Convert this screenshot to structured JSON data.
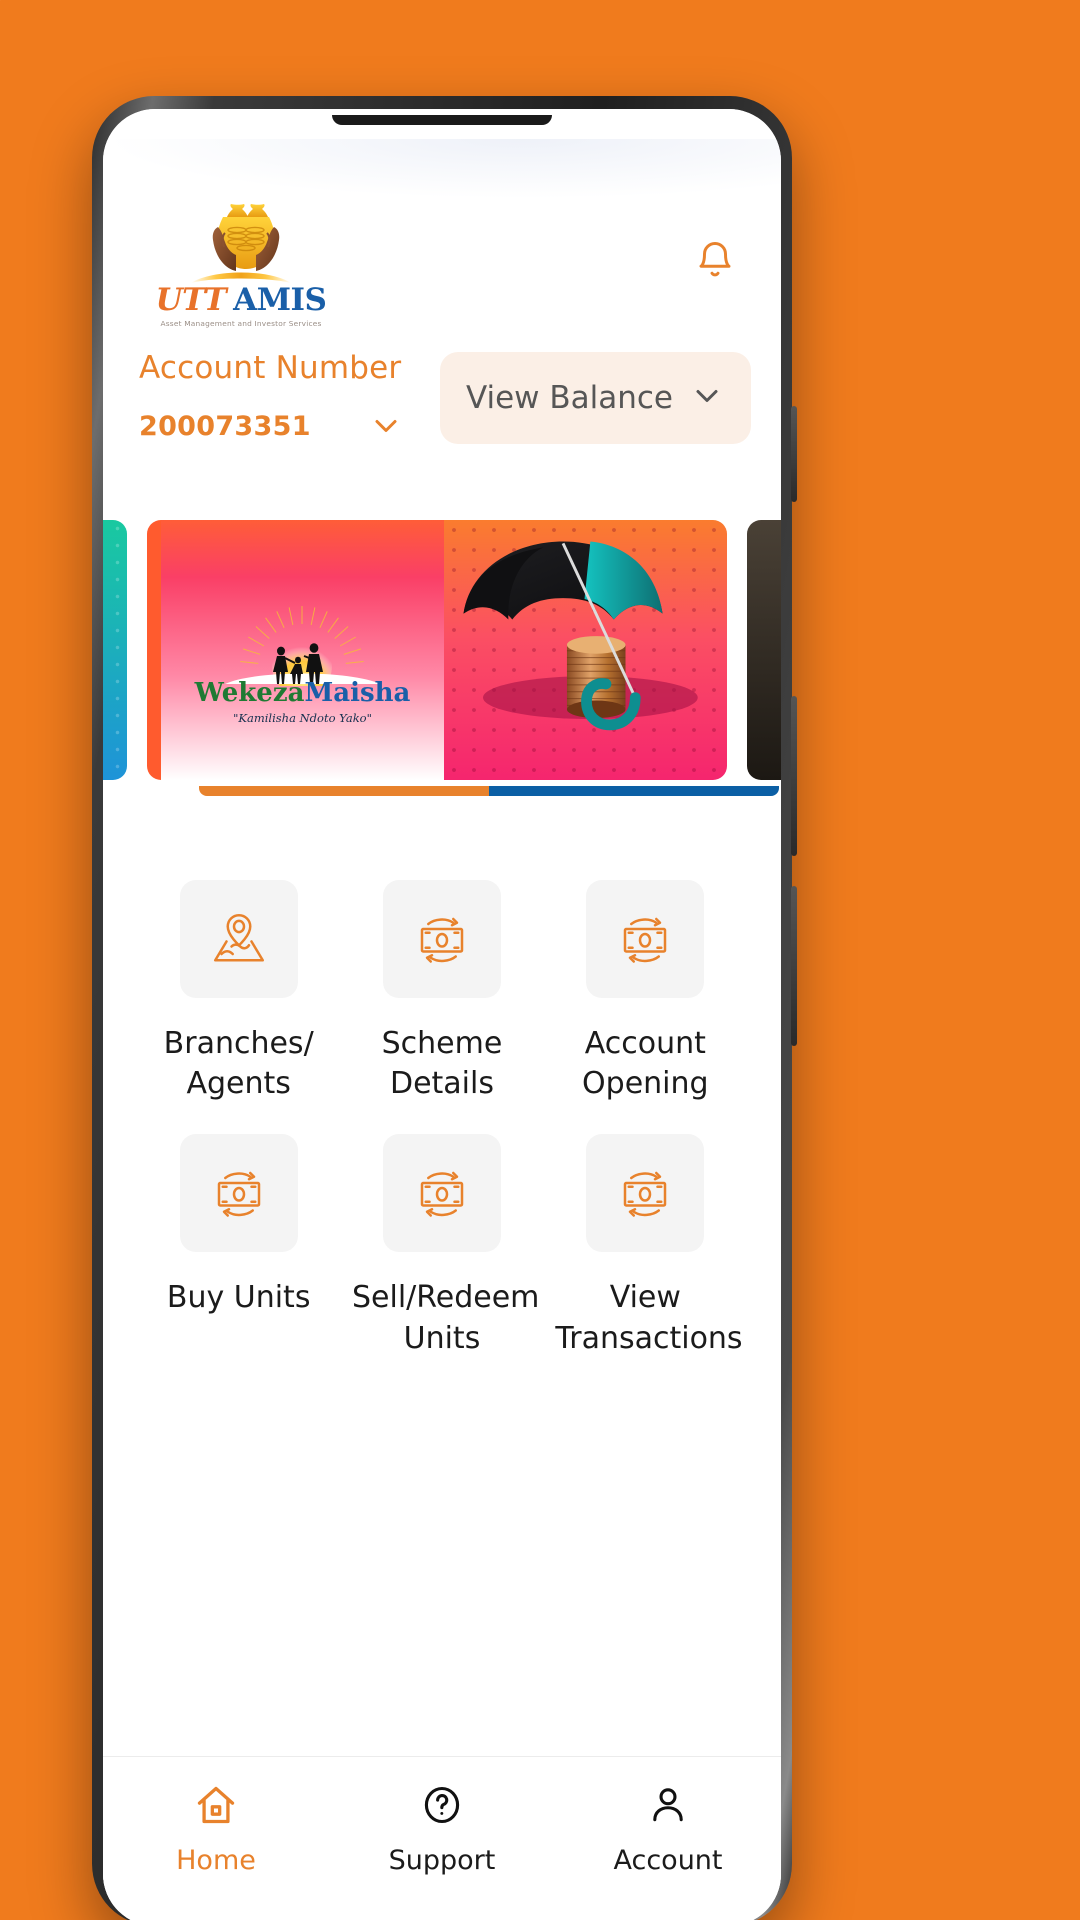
{
  "theme": {
    "brand_orange": "#E8822C",
    "backdrop_orange": "#F07B1D",
    "brand_blue": "#1A5FA8",
    "tile_grey": "#F4F4F4",
    "pill_cream": "#FBEFE6"
  },
  "header": {
    "logo": {
      "icon_name": "hands-holding-money-logo",
      "word_first": "UTT",
      "word_second": "AMIS",
      "tagline": "Asset Management and Investor Services"
    },
    "notification": {
      "icon_name": "bell-icon",
      "label": "Notifications"
    }
  },
  "account": {
    "label": "Account Number",
    "number": "200073351",
    "dropdown_icon": "chevron-down-icon",
    "view_balance": {
      "label": "View Balance",
      "icon_name": "chevron-down-icon"
    }
  },
  "carousel": {
    "slides": [
      {
        "id": "prev",
        "name": "promo-slide-previous",
        "title": ""
      },
      {
        "id": "active",
        "name": "promo-slide-wekeza-maisha",
        "brand_word_a": "W",
        "brand_word_a_rest": "ekeza",
        "brand_word_b": "M",
        "brand_word_b_rest": "aisha",
        "tagline": "\"Kamilisha Ndoto Yako\"",
        "artwork": "umbrella-over-coins"
      },
      {
        "id": "next",
        "name": "promo-slide-next",
        "title": ""
      }
    ],
    "indicator_bars": [
      "#E8822C",
      "#0B5FA5"
    ]
  },
  "menu": {
    "items": [
      {
        "label": "Branches/\nAgents",
        "icon_name": "map-pin-icon",
        "name": "menu-branches-agents"
      },
      {
        "label": "Scheme Details",
        "icon_name": "money-exchange-icon",
        "name": "menu-scheme-details"
      },
      {
        "label": "Account\nOpening",
        "icon_name": "money-exchange-icon",
        "name": "menu-account-opening"
      },
      {
        "label": "Buy Units",
        "icon_name": "money-exchange-icon",
        "name": "menu-buy-units"
      },
      {
        "label": "Sell/Redeem\nUnits",
        "icon_name": "money-exchange-icon",
        "name": "menu-sell-redeem-units"
      },
      {
        "label": "View\nTransactions",
        "icon_name": "money-exchange-icon",
        "name": "menu-view-transactions"
      }
    ]
  },
  "bottom_nav": {
    "items": [
      {
        "label": "Home",
        "icon_name": "home-icon",
        "active": true
      },
      {
        "label": "Support",
        "icon_name": "question-circle-icon",
        "active": false
      },
      {
        "label": "Account",
        "icon_name": "user-icon",
        "active": false
      }
    ]
  }
}
